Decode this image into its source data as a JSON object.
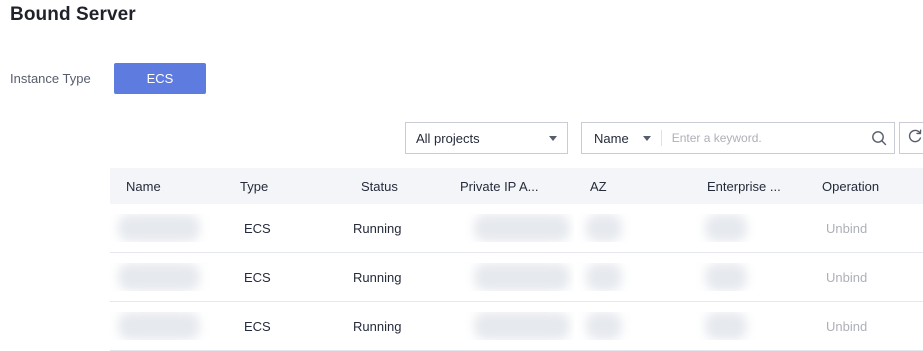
{
  "page": {
    "title": "Bound Server"
  },
  "instance_type": {
    "label": "Instance Type",
    "selected": "ECS"
  },
  "filters": {
    "project_value": "All projects",
    "search_key": "Name",
    "search_placeholder": "Enter a keyword."
  },
  "colors": {
    "primary": "#5e7ce0",
    "disabled_text": "#adb0b8",
    "header_bg": "#f3f5f8"
  },
  "table": {
    "columns": [
      "Name",
      "Type",
      "Status",
      "Private IP A...",
      "AZ",
      "Enterprise ...",
      "Operation"
    ],
    "rows": [
      {
        "type": "ECS",
        "status": "Running",
        "operation": "Unbind"
      },
      {
        "type": "ECS",
        "status": "Running",
        "operation": "Unbind"
      },
      {
        "type": "ECS",
        "status": "Running",
        "operation": "Unbind"
      }
    ]
  }
}
